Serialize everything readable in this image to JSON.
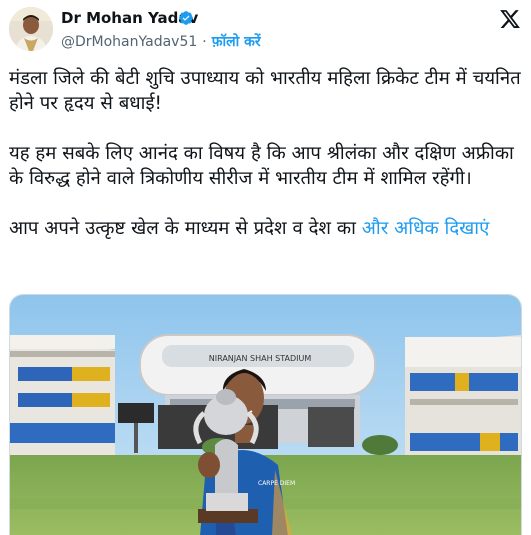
{
  "author": {
    "name": "Dr Mohan Yadav",
    "handle": "@DrMohanYadav51",
    "follow_label": "फ़ॉलो करें",
    "verified": true
  },
  "icons": {
    "avatar": "avatar-photo",
    "verified": "verified-badge-icon",
    "brand": "x-logo-icon"
  },
  "colors": {
    "accent": "#1d9bf0",
    "text": "#0f1419",
    "muted": "#536471"
  },
  "tweet": {
    "paragraph1": "मंडला जिले की बेटी शुचि उपाध्याय को भारतीय महिला क्रिकेट टीम में चयनित होने पर हृदय से बधाई!",
    "paragraph2": "यह हम सबके लिए आनंद का विषय है कि आप श्रीलंका और दक्षिण अफ्रीका के विरुद्ध होने वाले त्रिकोणीय सीरीज में भारतीय टीम में शामिल रहेंगी।",
    "paragraph3": "आप अपने उत्कृष्ट खेल के माध्यम से प्रदेश व देश का",
    "show_more": "और अधिक दिखाएं"
  },
  "media": {
    "stadium_sign": "NIRANJAN SHAH STADIUM",
    "jersey_text": "CARPE DIEM"
  }
}
